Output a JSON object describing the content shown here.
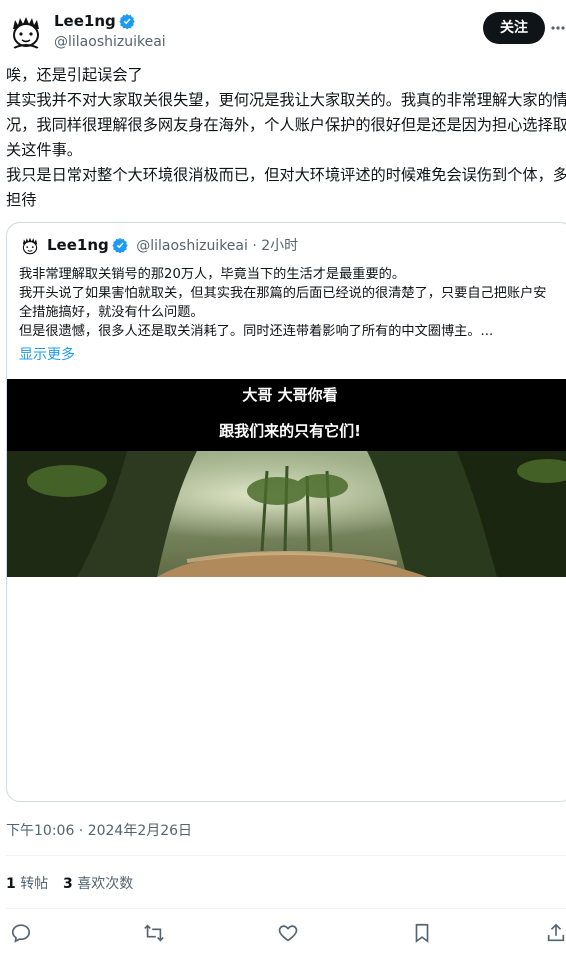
{
  "author": {
    "name": "Lee1ng",
    "handle": "@lilaoshizuikeai"
  },
  "follow_label": "关注",
  "tweet_text": "唉，还是引起误会了\n其实我并不对大家取关很失望，更何况是我让大家取关的。我真的非常理解大家的情况，我同样很理解很多网友身在海外，个人账户保护的很好但是还是因为担心选择取关这件事。\n我只是日常对整个大环境很消极而已，但对大环境评述的时候难免会误伤到个体，多担待",
  "quote": {
    "name": "Lee1ng",
    "handle": "@lilaoshizuikeai",
    "time": "· 2小时",
    "text": "我非常理解取关销号的那20万人，毕竟当下的生活才是最重要的。\n我开头说了如果害怕就取关，但其实我在那篇的后面已经说的很清楚了，只要自己把账户安全措施搞好，就没有什么问题。\n但是很遗憾，很多人还是取关消耗了。同时还连带着影响了所有的中文圈博主。...",
    "show_more": "显示更多",
    "media_caption_1": "大哥 大哥你看",
    "media_caption_2": "跟我们来的只有它们!"
  },
  "timestamp": "下午10:06 · 2024年2月26日",
  "stats": {
    "retweets_count": "1",
    "retweets_label": "转帖",
    "likes_count": "3",
    "likes_label": "喜欢次数"
  },
  "colors": {
    "accent": "#1d9bf0",
    "text": "#0f1419",
    "muted": "#536471"
  }
}
